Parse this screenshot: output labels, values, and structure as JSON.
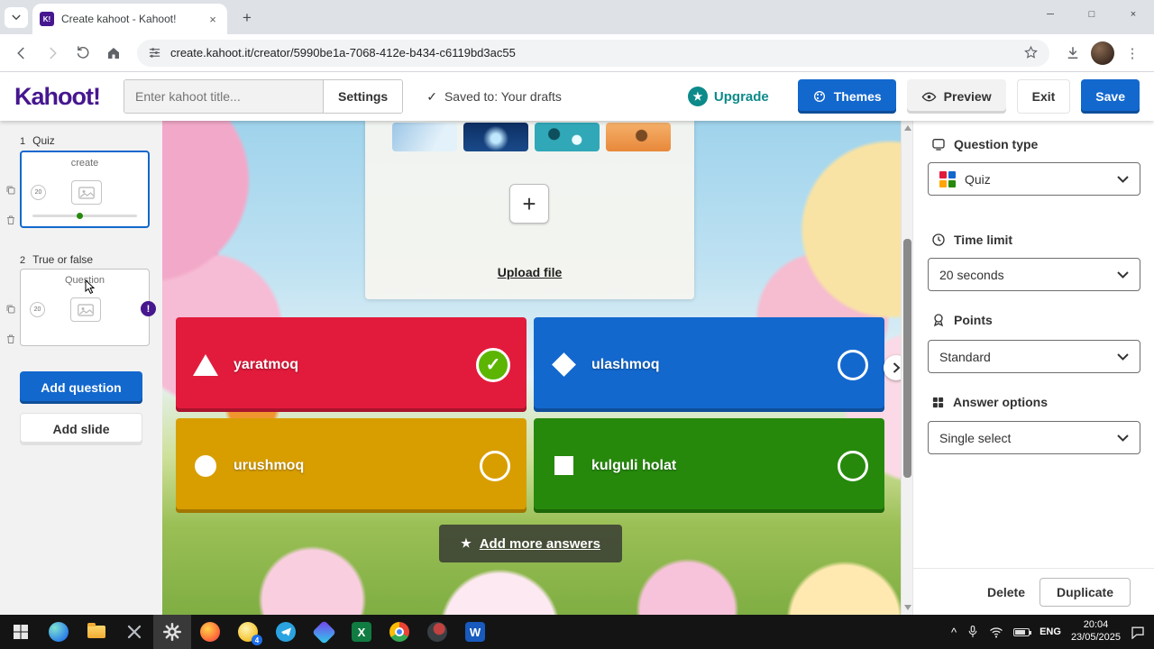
{
  "browser": {
    "tab_title": "Create kahoot - Kahoot!",
    "favicon_text": "K!",
    "url": "create.kahoot.it/creator/5990be1a-7068-412e-b434-c6119bd3ac55"
  },
  "glyphs": {
    "plus": "+",
    "check": "✓",
    "star": "★",
    "close": "×",
    "minimize": "─",
    "maximize": "□",
    "alert": "!",
    "dots_vertical": "⋮",
    "up_chevron": "^"
  },
  "header": {
    "logo_text": "Kahoot!",
    "title_placeholder": "Enter kahoot title...",
    "settings_label": "Settings",
    "saved_status": "Saved to: Your drafts",
    "upgrade_label": "Upgrade",
    "themes_label": "Themes",
    "preview_label": "Preview",
    "exit_label": "Exit",
    "save_label": "Save"
  },
  "sidebar": {
    "slides": [
      {
        "index": "1",
        "type": "Quiz",
        "title": "create",
        "time": "20"
      },
      {
        "index": "2",
        "type": "True or false",
        "title": "Question",
        "time": "20"
      }
    ],
    "add_question_label": "Add question",
    "add_slide_label": "Add slide"
  },
  "canvas": {
    "upload_label": "Upload file",
    "answers": [
      {
        "text": "yaratmoq",
        "shape": "triangle",
        "color": "#e21b3c",
        "correct": true
      },
      {
        "text": "ulashmoq",
        "shape": "diamond",
        "color": "#1368ce",
        "correct": false
      },
      {
        "text": "urushmoq",
        "shape": "circle",
        "color": "#d89e00",
        "correct": false
      },
      {
        "text": "kulguli holat",
        "shape": "square",
        "color": "#26890c",
        "correct": false
      }
    ],
    "add_more_label": "Add more answers"
  },
  "panel": {
    "question_type_label": "Question type",
    "question_type_value": "Quiz",
    "time_limit_label": "Time limit",
    "time_limit_value": "20 seconds",
    "points_label": "Points",
    "points_value": "Standard",
    "answer_options_label": "Answer options",
    "answer_options_value": "Single select",
    "delete_label": "Delete",
    "duplicate_label": "Duplicate"
  },
  "taskbar": {
    "time": "20:04",
    "date": "23/05/2025",
    "language": "ENG",
    "excel_letter": "X",
    "word_letter": "W",
    "badge_count": "4"
  },
  "colors": {
    "kahoot_purple": "#46178f",
    "kahoot_blue": "#1368ce",
    "answer_red": "#e21b3c",
    "answer_blue": "#1368ce",
    "answer_yellow": "#d89e00",
    "answer_green": "#26890c",
    "correct_green": "#5cb502",
    "upgrade_teal": "#0d8a8a"
  }
}
